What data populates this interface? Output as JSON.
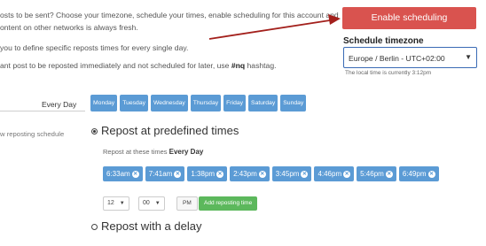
{
  "intro": {
    "line1": "osts to be sent? Choose your timezone, schedule your times, enable scheduling for this account and",
    "line2": "ontent on other networks is always fresh.",
    "line3": "you to define specific reposts times for every single day.",
    "line4_pre": "ant post to be reposted immediately and not scheduled for later, use ",
    "line4_tag": "#nq",
    "line4_post": " hashtag."
  },
  "enable_button": "Enable scheduling",
  "timezone": {
    "title": "Schedule timezone",
    "value": "Europe / Berlin - UTC+02:00",
    "note": "The local time is currently 3:12pm"
  },
  "left": {
    "every_day": "Every Day",
    "new_schedule": "w reposting schedule"
  },
  "days": [
    "Monday",
    "Tuesday",
    "Wednesday",
    "Thursday",
    "Friday",
    "Saturday",
    "Sunday"
  ],
  "predefined": {
    "title": "Repost at predefined times",
    "sub_pre": "Repost at these times",
    "sub_bold": "Every Day",
    "times": [
      "6:33am",
      "7:41am",
      "1:38pm",
      "2:43pm",
      "3:45pm",
      "4:46pm",
      "5:46pm",
      "6:49pm"
    ]
  },
  "add_time": {
    "hour": "12",
    "minute": "00",
    "ampm": "PM",
    "button": "Add reposting time"
  },
  "delay": {
    "title": "Repost with a delay"
  },
  "colors": {
    "accent_red": "#d9534f",
    "accent_blue": "#5b9bd5",
    "accent_green": "#5cb85c",
    "arrow": "#a3201c"
  }
}
